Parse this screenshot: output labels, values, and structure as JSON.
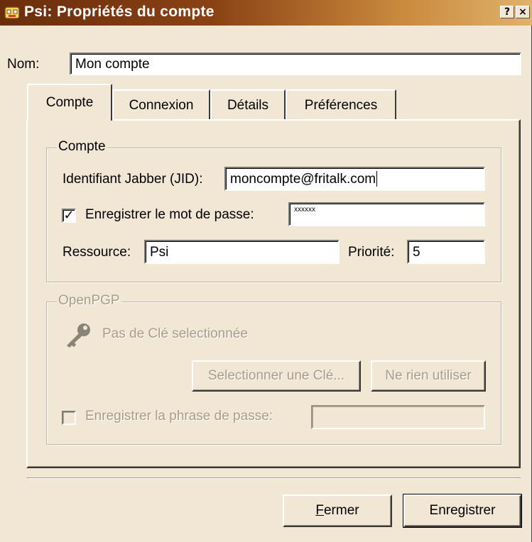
{
  "window": {
    "title": "Psi: Propriétés du compte",
    "help_glyph": "?",
    "close_glyph": "×"
  },
  "name_row": {
    "label": "Nom:",
    "value": "Mon compte"
  },
  "tabs": [
    {
      "label": "Compte",
      "active": true
    },
    {
      "label": "Connexion",
      "active": false
    },
    {
      "label": "Détails",
      "active": false
    },
    {
      "label": "Préférences",
      "active": false
    }
  ],
  "account_group": {
    "legend": "Compte",
    "jid_label": "Identifiant Jabber (JID):",
    "jid_value": "moncompte@fritalk.com",
    "save_password_checked": true,
    "save_password_label": "Enregistrer le mot de passe:",
    "password_value": "xxxxxx",
    "resource_label": "Ressource:",
    "resource_value": "Psi",
    "priority_label": "Priorité:",
    "priority_value": "5"
  },
  "openpgp_group": {
    "legend": "OpenPGP",
    "key_icon": "key-icon",
    "no_key_text": "Pas de Clé selectionnée",
    "select_key_label": "Selectionner une Clé...",
    "no_use_label": "Ne rien utiliser",
    "save_passphrase_checked": false,
    "save_passphrase_label": "Enregistrer la phrase de passe:",
    "passphrase_value": ""
  },
  "buttons": {
    "close_label": "Fermer",
    "save_label": "Enregistrer"
  }
}
